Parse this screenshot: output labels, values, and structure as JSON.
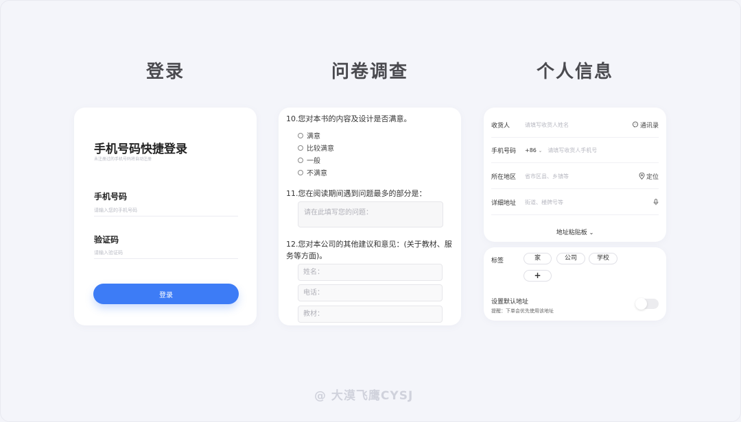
{
  "sections": {
    "login_title": "登录",
    "survey_title": "问卷调查",
    "info_title": "个人信息"
  },
  "login": {
    "heading": "手机号码快捷登录",
    "subtext": "未注册过的手机号码将自动注册",
    "phone_label": "手机号码",
    "phone_placeholder": "请输入您的手机号码",
    "code_label": "验证码",
    "code_placeholder": "请输入验证码",
    "button": "登录"
  },
  "survey": {
    "q10": "10.您对本书的内容及设计是否满意。",
    "q10_options": [
      "满意",
      "比较满意",
      "一般",
      "不满意"
    ],
    "q11": "11.您在阅读期间遇到问题最多的部分是：",
    "q11_placeholder": "请在此填写您的问题：",
    "q12": "12.您对本公司的其他建议和意见：(关于教材、服务等方面)。",
    "name_placeholder": "姓名：",
    "phone_placeholder": "电话：",
    "material_placeholder": "教材："
  },
  "info": {
    "recipient_label": "收货人",
    "recipient_placeholder": "请填写收货人姓名",
    "contacts_action": "通讯录",
    "phone_label": "手机号码",
    "country_code": "+86",
    "phone_placeholder": "请填写收货人手机号",
    "region_label": "所在地区",
    "region_placeholder": "省市区县、乡镇等",
    "locate_action": "定位",
    "address_label": "详细地址",
    "address_placeholder": "街道、楼牌号等",
    "paste_board": "地址粘贴板",
    "tag_label": "标签",
    "tags": [
      "家",
      "公司",
      "学校"
    ],
    "add_tag": "+",
    "default_label": "设置默认地址",
    "default_hint": "提醒：下单会优先使用该地址",
    "default_on": false
  },
  "watermark": "@ 大漠飞鹰CYSJ",
  "colors": {
    "primary": "#3d7cf6",
    "background": "#f4f5fa"
  }
}
